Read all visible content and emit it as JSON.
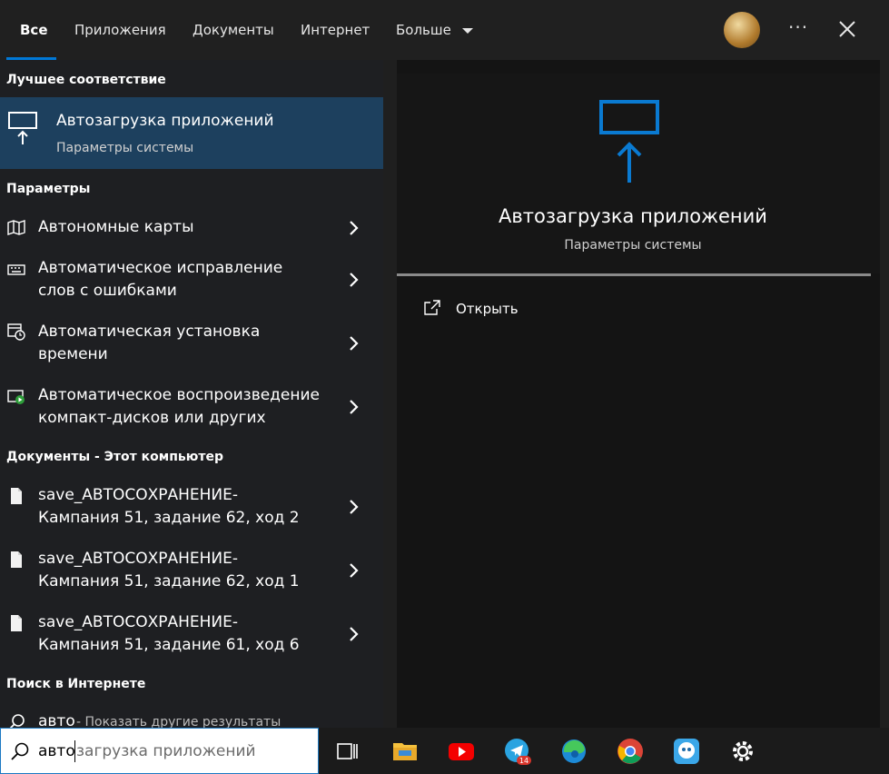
{
  "tabs": [
    {
      "label": "Все"
    },
    {
      "label": "Приложения"
    },
    {
      "label": "Документы"
    },
    {
      "label": "Интернет"
    },
    {
      "label": "Больше"
    }
  ],
  "sections": {
    "best_match": "Лучшее соответствие",
    "settings": "Параметры",
    "documents": "Документы - Этот компьютер",
    "web": "Поиск в Интернете"
  },
  "best_match": {
    "title": "Автозагрузка приложений",
    "subtitle": "Параметры системы",
    "icon": "startup-apps-icon"
  },
  "settings_items": [
    {
      "line1": "Автономные карты",
      "line2": "",
      "icon": "map-download-icon"
    },
    {
      "line1": "Автоматическое исправление",
      "line2": "слов с ошибками",
      "icon": "keyboard-icon"
    },
    {
      "line1": "Автоматическая установка",
      "line2": "времени",
      "icon": "calendar-clock-icon"
    },
    {
      "line1": "Автоматическое воспроизведение",
      "line2": "компакт-дисков или других",
      "icon": "autoplay-icon"
    }
  ],
  "document_items": [
    {
      "line1": "save_АВТОСОХРАНЕНИЕ-",
      "line2": "Кампания 51, задание 62, ход 2",
      "icon": "document-icon"
    },
    {
      "line1": "save_АВТОСОХРАНЕНИЕ-",
      "line2": "Кампания 51, задание 62, ход 1",
      "icon": "document-icon"
    },
    {
      "line1": "save_АВТОСОХРАНЕНИЕ-",
      "line2": "Кампания 51, задание 61, ход 6",
      "icon": "document-icon"
    }
  ],
  "web_item": {
    "query": "авто",
    "hint": "- Показать другие результаты"
  },
  "preview": {
    "title": "Автозагрузка приложений",
    "subtitle": "Параметры системы",
    "open_label": "Открыть"
  },
  "search": {
    "typed": "авто",
    "completion": "загрузка приложений"
  },
  "taskbar": {
    "icons": [
      "task-view-icon",
      "file-explorer-icon",
      "youtube-icon",
      "telegram-icon",
      "edge-icon",
      "chrome-icon",
      "app-icon",
      "settings-icon"
    ],
    "telegram_badge": "14"
  },
  "colors": {
    "accent": "#0078d7",
    "selected_bg": "#1d405e"
  }
}
